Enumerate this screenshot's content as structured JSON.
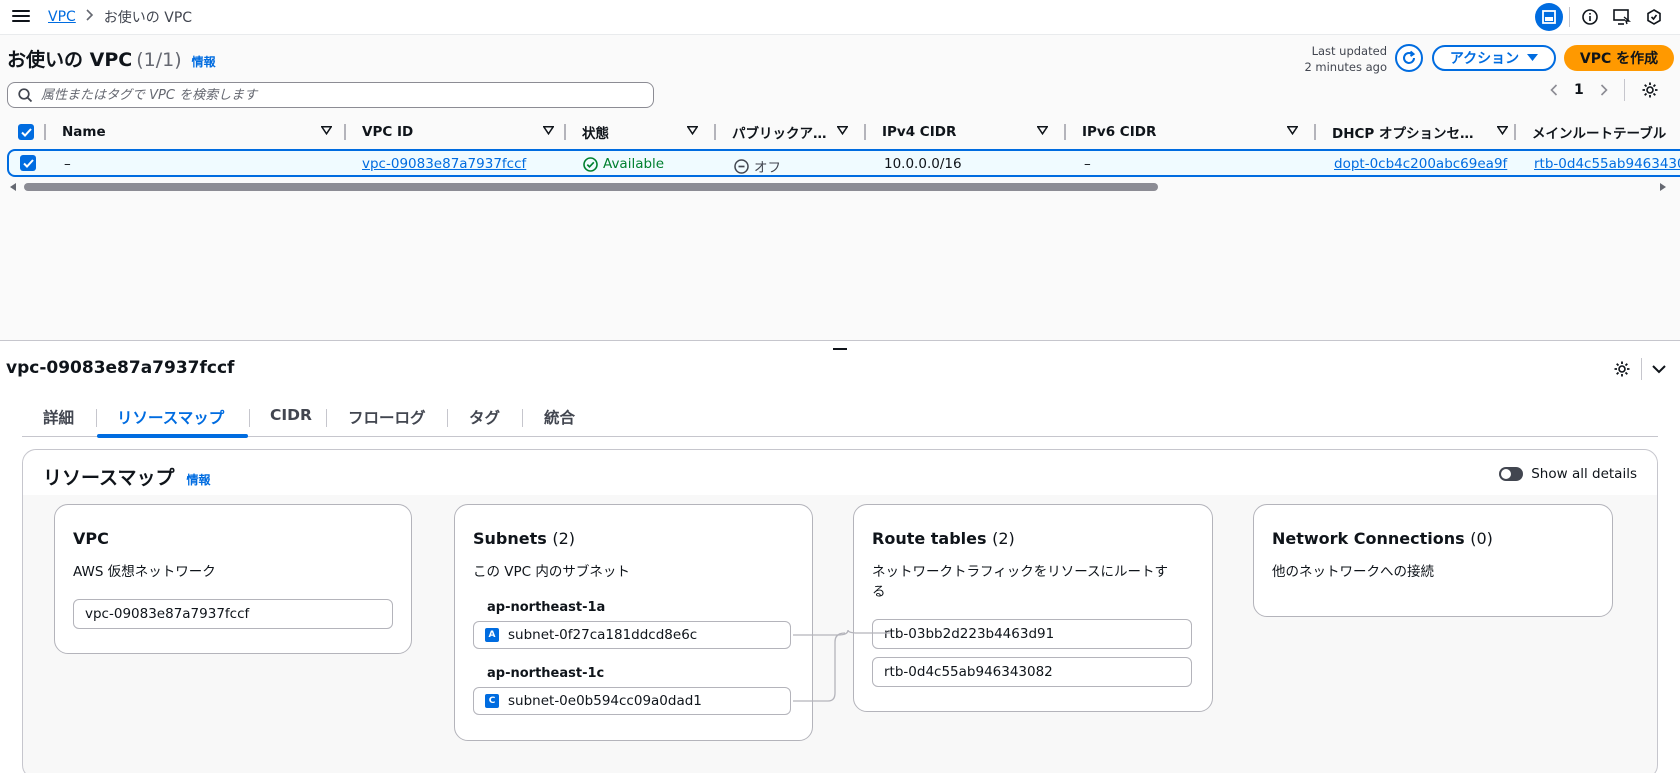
{
  "breadcrumb": {
    "root": "VPC",
    "current": "お使いの VPC"
  },
  "list": {
    "title": "お使いの VPC",
    "count": "(1/1)",
    "info": "情報",
    "last_updated_line1": "Last updated",
    "last_updated_line2": "2 minutes ago",
    "actions_label": "アクション",
    "create_label": "VPC を作成",
    "search_placeholder": "属性またはタグで VPC を検索します",
    "page": "1"
  },
  "table": {
    "columns": [
      "Name",
      "VPC ID",
      "状態",
      "パブリックア…",
      "IPv4 CIDR",
      "IPv6 CIDR",
      "DHCP オプションセ…",
      "メインルートテーブル"
    ],
    "row": {
      "name": "–",
      "vpc_id": "vpc-09083e87a7937fccf",
      "state": "Available",
      "public_access": "オフ",
      "ipv4": "10.0.0.0/16",
      "ipv6": "–",
      "dhcp": "dopt-0cb4c200abc69ea9f",
      "main_rt": "rtb-0d4c55ab9463430"
    }
  },
  "details": {
    "title": "vpc-09083e87a7937fccf",
    "tabs": [
      "詳細",
      "リソースマップ",
      "CIDR",
      "フローログ",
      "タグ",
      "統合"
    ],
    "active_tab": "リソースマップ"
  },
  "resource_map": {
    "title": "リソースマップ",
    "info": "情報",
    "toggle_label": "Show all details",
    "vpc": {
      "title": "VPC",
      "subtitle": "AWS 仮想ネットワーク",
      "value": "vpc-09083e87a7937fccf"
    },
    "subnets": {
      "title": "Subnets",
      "count": "(2)",
      "subtitle": "この VPC 内のサブネット",
      "zones": [
        {
          "name": "ap-northeast-1a",
          "badge": "A",
          "subnet": "subnet-0f27ca181ddcd8e6c"
        },
        {
          "name": "ap-northeast-1c",
          "badge": "C",
          "subnet": "subnet-0e0b594cc09a0dad1"
        }
      ]
    },
    "route_tables": {
      "title": "Route tables",
      "count": "(2)",
      "subtitle_line1": "ネットワークトラフィックをリソースにルートす",
      "subtitle_line2": "る",
      "items": [
        "rtb-03bb2d223b4463d91",
        "rtb-0d4c55ab946343082"
      ]
    },
    "network_connections": {
      "title": "Network Connections",
      "count": "(0)",
      "subtitle": "他のネットワークへの接続"
    }
  },
  "colors": {
    "accent": "#006ce0",
    "primary_button": "#ff9900",
    "success": "#00802f"
  }
}
